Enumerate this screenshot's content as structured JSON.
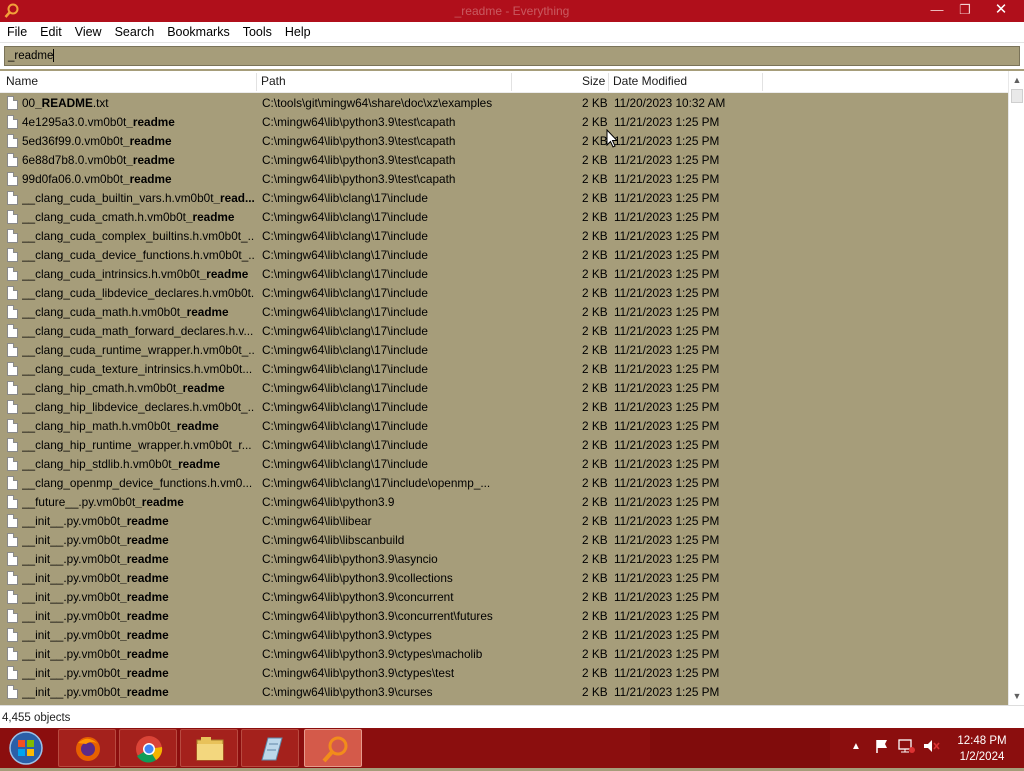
{
  "window": {
    "title": "_readme - Everything"
  },
  "menu": [
    "File",
    "Edit",
    "View",
    "Search",
    "Bookmarks",
    "Tools",
    "Help"
  ],
  "search": {
    "value": "_readme"
  },
  "columns": {
    "name": "Name",
    "path": "Path",
    "size": "Size",
    "date": "Date Modified"
  },
  "rows": [
    {
      "pre": "00",
      "hl": "_README",
      "post": ".txt",
      "path": "C:\\tools\\git\\mingw64\\share\\doc\\xz\\examples",
      "size": "2 KB",
      "date": "11/20/2023 10:32 AM"
    },
    {
      "pre": "4e1295a3.0.vm0b0t",
      "hl": "_readme",
      "post": "",
      "path": "C:\\mingw64\\lib\\python3.9\\test\\capath",
      "size": "2 KB",
      "date": "11/21/2023 1:25 PM"
    },
    {
      "pre": "5ed36f99.0.vm0b0t",
      "hl": "_readme",
      "post": "",
      "path": "C:\\mingw64\\lib\\python3.9\\test\\capath",
      "size": "2 KB",
      "date": "11/21/2023 1:25 PM"
    },
    {
      "pre": "6e88d7b8.0.vm0b0t",
      "hl": "_readme",
      "post": "",
      "path": "C:\\mingw64\\lib\\python3.9\\test\\capath",
      "size": "2 KB",
      "date": "11/21/2023 1:25 PM"
    },
    {
      "pre": "99d0fa06.0.vm0b0t",
      "hl": "_readme",
      "post": "",
      "path": "C:\\mingw64\\lib\\python3.9\\test\\capath",
      "size": "2 KB",
      "date": "11/21/2023 1:25 PM"
    },
    {
      "pre": "__clang_cuda_builtin_vars.h.vm0b0t",
      "hl": "_read...",
      "post": "",
      "path": "C:\\mingw64\\lib\\clang\\17\\include",
      "size": "2 KB",
      "date": "11/21/2023 1:25 PM"
    },
    {
      "pre": "__clang_cuda_cmath.h.vm0b0t",
      "hl": "_readme",
      "post": "",
      "path": "C:\\mingw64\\lib\\clang\\17\\include",
      "size": "2 KB",
      "date": "11/21/2023 1:25 PM"
    },
    {
      "pre": "__clang_cuda_complex_builtins.h.vm0b0t_...",
      "hl": "",
      "post": "",
      "path": "C:\\mingw64\\lib\\clang\\17\\include",
      "size": "2 KB",
      "date": "11/21/2023 1:25 PM"
    },
    {
      "pre": "__clang_cuda_device_functions.h.vm0b0t_...",
      "hl": "",
      "post": "",
      "path": "C:\\mingw64\\lib\\clang\\17\\include",
      "size": "2 KB",
      "date": "11/21/2023 1:25 PM"
    },
    {
      "pre": "__clang_cuda_intrinsics.h.vm0b0t",
      "hl": "_readme",
      "post": "",
      "path": "C:\\mingw64\\lib\\clang\\17\\include",
      "size": "2 KB",
      "date": "11/21/2023 1:25 PM"
    },
    {
      "pre": "__clang_cuda_libdevice_declares.h.vm0b0t...",
      "hl": "",
      "post": "",
      "path": "C:\\mingw64\\lib\\clang\\17\\include",
      "size": "2 KB",
      "date": "11/21/2023 1:25 PM"
    },
    {
      "pre": "__clang_cuda_math.h.vm0b0t",
      "hl": "_readme",
      "post": "",
      "path": "C:\\mingw64\\lib\\clang\\17\\include",
      "size": "2 KB",
      "date": "11/21/2023 1:25 PM"
    },
    {
      "pre": "__clang_cuda_math_forward_declares.h.v...",
      "hl": "",
      "post": "",
      "path": "C:\\mingw64\\lib\\clang\\17\\include",
      "size": "2 KB",
      "date": "11/21/2023 1:25 PM"
    },
    {
      "pre": "__clang_cuda_runtime_wrapper.h.vm0b0t_...",
      "hl": "",
      "post": "",
      "path": "C:\\mingw64\\lib\\clang\\17\\include",
      "size": "2 KB",
      "date": "11/21/2023 1:25 PM"
    },
    {
      "pre": "__clang_cuda_texture_intrinsics.h.vm0b0t...",
      "hl": "",
      "post": "",
      "path": "C:\\mingw64\\lib\\clang\\17\\include",
      "size": "2 KB",
      "date": "11/21/2023 1:25 PM"
    },
    {
      "pre": "__clang_hip_cmath.h.vm0b0t",
      "hl": "_readme",
      "post": "",
      "path": "C:\\mingw64\\lib\\clang\\17\\include",
      "size": "2 KB",
      "date": "11/21/2023 1:25 PM"
    },
    {
      "pre": "__clang_hip_libdevice_declares.h.vm0b0t_...",
      "hl": "",
      "post": "",
      "path": "C:\\mingw64\\lib\\clang\\17\\include",
      "size": "2 KB",
      "date": "11/21/2023 1:25 PM"
    },
    {
      "pre": "__clang_hip_math.h.vm0b0t",
      "hl": "_readme",
      "post": "",
      "path": "C:\\mingw64\\lib\\clang\\17\\include",
      "size": "2 KB",
      "date": "11/21/2023 1:25 PM"
    },
    {
      "pre": "__clang_hip_runtime_wrapper.h.vm0b0t_r...",
      "hl": "",
      "post": "",
      "path": "C:\\mingw64\\lib\\clang\\17\\include",
      "size": "2 KB",
      "date": "11/21/2023 1:25 PM"
    },
    {
      "pre": "__clang_hip_stdlib.h.vm0b0t",
      "hl": "_readme",
      "post": "",
      "path": "C:\\mingw64\\lib\\clang\\17\\include",
      "size": "2 KB",
      "date": "11/21/2023 1:25 PM"
    },
    {
      "pre": "__clang_openmp_device_functions.h.vm0...",
      "hl": "",
      "post": "",
      "path": "C:\\mingw64\\lib\\clang\\17\\include\\openmp_...",
      "size": "2 KB",
      "date": "11/21/2023 1:25 PM"
    },
    {
      "pre": "__future__.py.vm0b0t",
      "hl": "_readme",
      "post": "",
      "path": "C:\\mingw64\\lib\\python3.9",
      "size": "2 KB",
      "date": "11/21/2023 1:25 PM"
    },
    {
      "pre": "__init__.py.vm0b0t",
      "hl": "_readme",
      "post": "",
      "path": "C:\\mingw64\\lib\\libear",
      "size": "2 KB",
      "date": "11/21/2023 1:25 PM"
    },
    {
      "pre": "__init__.py.vm0b0t",
      "hl": "_readme",
      "post": "",
      "path": "C:\\mingw64\\lib\\libscanbuild",
      "size": "2 KB",
      "date": "11/21/2023 1:25 PM"
    },
    {
      "pre": "__init__.py.vm0b0t",
      "hl": "_readme",
      "post": "",
      "path": "C:\\mingw64\\lib\\python3.9\\asyncio",
      "size": "2 KB",
      "date": "11/21/2023 1:25 PM"
    },
    {
      "pre": "__init__.py.vm0b0t",
      "hl": "_readme",
      "post": "",
      "path": "C:\\mingw64\\lib\\python3.9\\collections",
      "size": "2 KB",
      "date": "11/21/2023 1:25 PM"
    },
    {
      "pre": "__init__.py.vm0b0t",
      "hl": "_readme",
      "post": "",
      "path": "C:\\mingw64\\lib\\python3.9\\concurrent",
      "size": "2 KB",
      "date": "11/21/2023 1:25 PM"
    },
    {
      "pre": "__init__.py.vm0b0t",
      "hl": "_readme",
      "post": "",
      "path": "C:\\mingw64\\lib\\python3.9\\concurrent\\futures",
      "size": "2 KB",
      "date": "11/21/2023 1:25 PM"
    },
    {
      "pre": "__init__.py.vm0b0t",
      "hl": "_readme",
      "post": "",
      "path": "C:\\mingw64\\lib\\python3.9\\ctypes",
      "size": "2 KB",
      "date": "11/21/2023 1:25 PM"
    },
    {
      "pre": "__init__.py.vm0b0t",
      "hl": "_readme",
      "post": "",
      "path": "C:\\mingw64\\lib\\python3.9\\ctypes\\macholib",
      "size": "2 KB",
      "date": "11/21/2023 1:25 PM"
    },
    {
      "pre": "__init__.py.vm0b0t",
      "hl": "_readme",
      "post": "",
      "path": "C:\\mingw64\\lib\\python3.9\\ctypes\\test",
      "size": "2 KB",
      "date": "11/21/2023 1:25 PM"
    },
    {
      "pre": "__init__.py.vm0b0t",
      "hl": "_readme",
      "post": "",
      "path": "C:\\mingw64\\lib\\python3.9\\curses",
      "size": "2 KB",
      "date": "11/21/2023 1:25 PM"
    }
  ],
  "status": {
    "count": "4,455 objects"
  },
  "taskbar": {
    "apps": [
      "start-orb-icon",
      "firefox-icon",
      "chrome-icon",
      "file-explorer-icon",
      "notepad-icon",
      "everything-search-icon"
    ],
    "clock_time": "12:48 PM",
    "clock_date": "1/2/2024"
  },
  "colors": {
    "titlebar": "#b00f1b",
    "list_bg": "#a69d7a",
    "taskbar": "#8b0e0e"
  }
}
